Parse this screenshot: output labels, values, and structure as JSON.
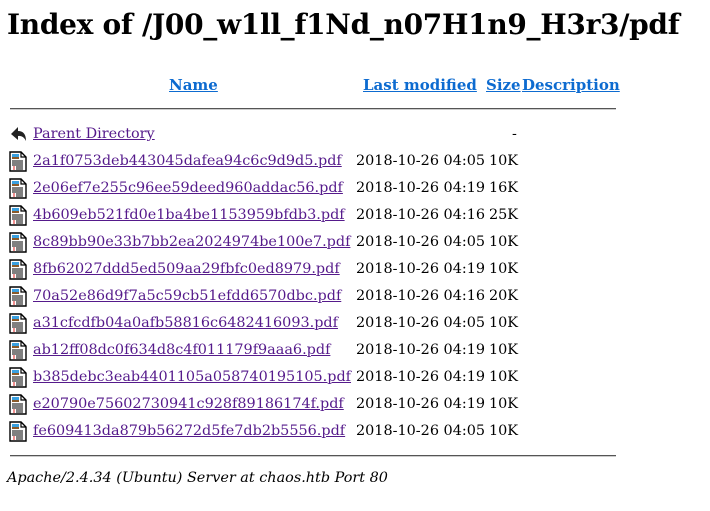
{
  "title": "Index of /J00_w1ll_f1Nd_n07H1n9_H3r3/pdf",
  "columns": {
    "name": "Name",
    "last_modified": "Last modified",
    "size": "Size",
    "description": "Description"
  },
  "parent": {
    "label": "Parent Directory",
    "size": "-"
  },
  "files": [
    {
      "name": "2a1f0753deb443045dafea94c6c9d9d5.pdf",
      "modified": "2018-10-26 04:05",
      "size": "10K"
    },
    {
      "name": "2e06ef7e255c96ee59deed960addac56.pdf",
      "modified": "2018-10-26 04:19",
      "size": "16K"
    },
    {
      "name": "4b609eb521fd0e1ba4be1153959bfdb3.pdf",
      "modified": "2018-10-26 04:16",
      "size": "25K"
    },
    {
      "name": "8c89bb90e33b7bb2ea2024974be100e7.pdf",
      "modified": "2018-10-26 04:05",
      "size": "10K"
    },
    {
      "name": "8fb62027ddd5ed509aa29fbfc0ed8979.pdf",
      "modified": "2018-10-26 04:19",
      "size": "10K"
    },
    {
      "name": "70a52e86d9f7a5c59cb51efdd6570dbc.pdf",
      "modified": "2018-10-26 04:16",
      "size": "20K"
    },
    {
      "name": "a31cfcdfb04a0afb58816c6482416093.pdf",
      "modified": "2018-10-26 04:05",
      "size": "10K"
    },
    {
      "name": "ab12ff08dc0f634d8c4f011179f9aaa6.pdf",
      "modified": "2018-10-26 04:19",
      "size": "10K"
    },
    {
      "name": "b385debc3eab4401105a058740195105.pdf",
      "modified": "2018-10-26 04:19",
      "size": "10K"
    },
    {
      "name": "e20790e75602730941c928f89186174f.pdf",
      "modified": "2018-10-26 04:19",
      "size": "10K"
    },
    {
      "name": "fe609413da879b56272d5fe7db2b5556.pdf",
      "modified": "2018-10-26 04:05",
      "size": "10K"
    }
  ],
  "footer": "Apache/2.4.34 (Ubuntu) Server at chaos.htb Port 80",
  "colors": {
    "header_link": "#0d6bd0",
    "visited_link": "#551a8b"
  }
}
